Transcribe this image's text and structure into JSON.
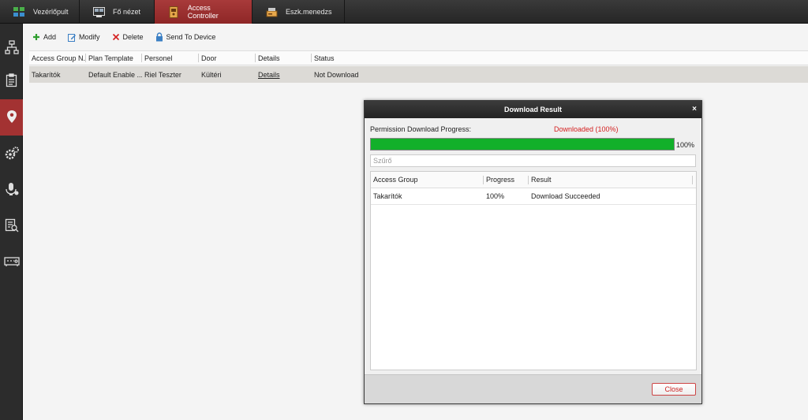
{
  "tabs": [
    {
      "label": "Vezérlőpult",
      "icon": "dashboard-icon"
    },
    {
      "label": "Fő nézet",
      "icon": "main-view-icon"
    },
    {
      "label": "Access Controller",
      "icon": "access-controller-icon"
    },
    {
      "label": "Eszk.menedzs",
      "icon": "device-management-icon"
    }
  ],
  "sidebar": [
    "network-icon",
    "clipboard-icon",
    "location-pin-icon",
    "gear-settings-icon",
    "intercom-icon",
    "report-search-icon",
    "device-icon"
  ],
  "toolbar": {
    "add": "Add",
    "modify": "Modify",
    "delete": "Delete",
    "send": "Send To Device"
  },
  "table": {
    "headers": [
      "Access Group N...",
      "Plan Template",
      "Personel",
      "Door",
      "Details",
      "Status"
    ],
    "rows": [
      [
        "Takarítók",
        "Default Enable ...",
        "Riel Teszter",
        "Kültéri",
        "Details",
        "Not Download"
      ]
    ]
  },
  "dialog": {
    "title": "Download Result",
    "close_symbol": "×",
    "progress_label": "Permission Download Progress:",
    "progress_status": "Downloaded (100%)",
    "progress_value": 1.0,
    "progress_percent_text": "100%",
    "filter_placeholder": "Szűrő",
    "headers": [
      "Access Group",
      "Progress",
      "Result"
    ],
    "rows": [
      [
        "Takarítók",
        "100%",
        "Download Succeeded"
      ]
    ],
    "close_button": "Close"
  },
  "colors": {
    "accent": "#a33232",
    "progress": "#12b02a",
    "status_red": "#d42020"
  }
}
